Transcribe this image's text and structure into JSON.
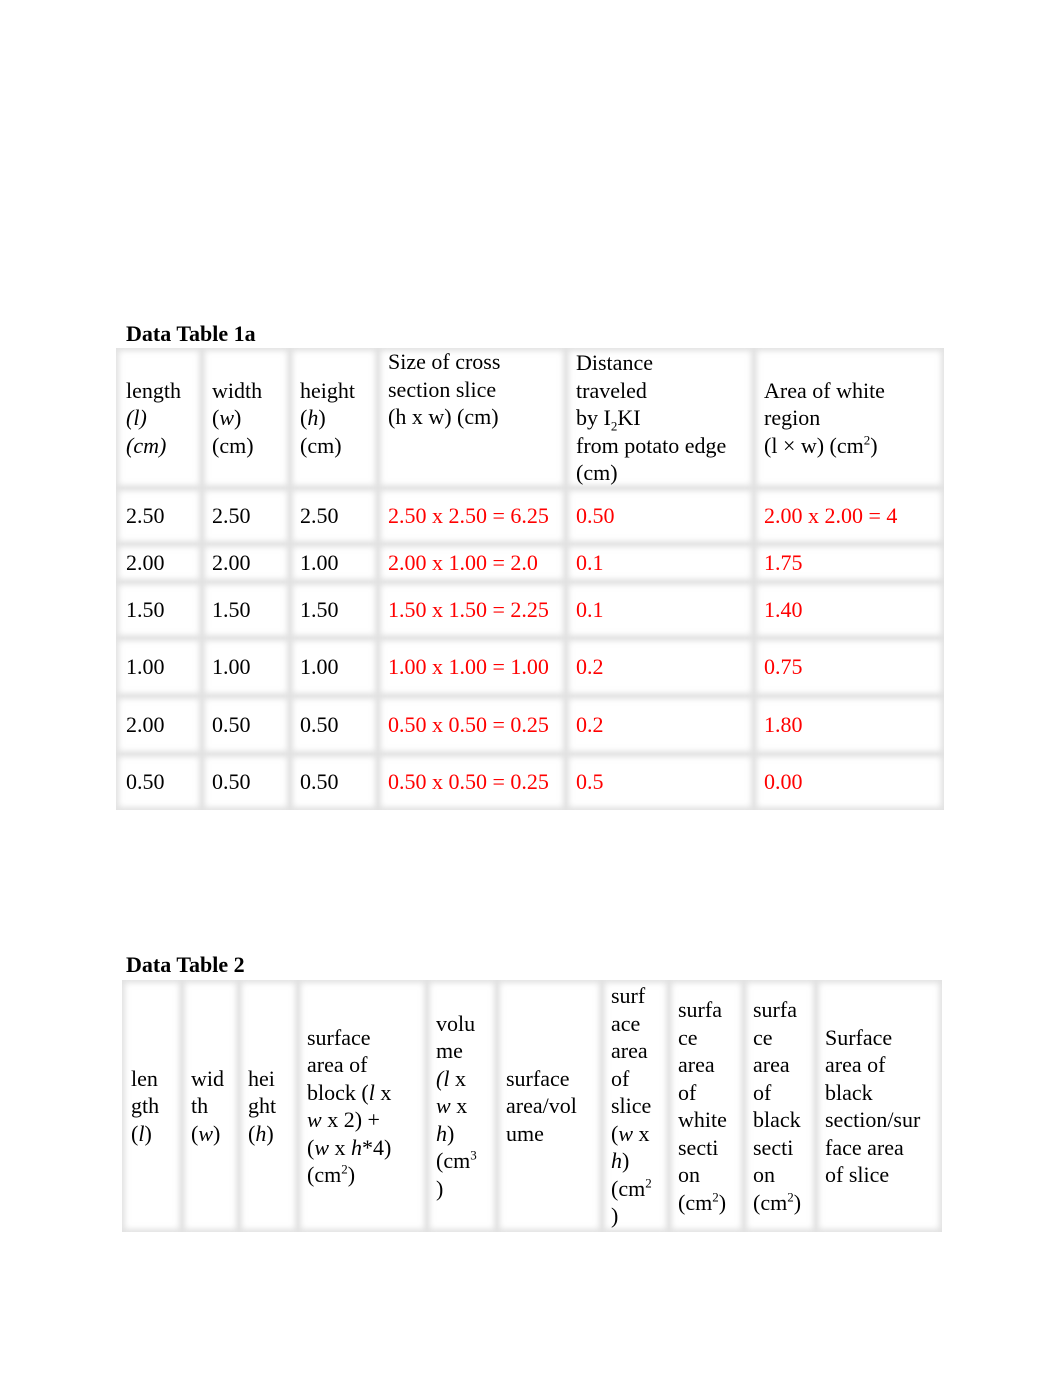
{
  "table1": {
    "caption": "Data Table 1a",
    "headers": {
      "length": [
        "length",
        "(",
        "l",
        ")",
        "(cm)"
      ],
      "width": [
        "width",
        "(",
        "w",
        ")",
        "(cm)"
      ],
      "height": [
        "height",
        "(",
        "h",
        ")",
        "(cm)"
      ],
      "cross_section": [
        "Size of cross",
        "section slice",
        "(h x w) (cm)"
      ],
      "distance": [
        "Distance",
        "traveled",
        "by I",
        "2",
        "KI",
        "from potato edge",
        "(cm)"
      ],
      "white_area": [
        "Area of white",
        "region",
        "(l × w) (cm",
        "2",
        ")"
      ]
    },
    "rows": [
      {
        "length": "2.50",
        "width": "2.50",
        "height": "2.50",
        "cross_section": "2.50 x 2.50 = 6.25",
        "distance": "0.50",
        "white_area": "2.00 x 2.00 = 4"
      },
      {
        "length": "2.00",
        "width": "2.00",
        "height": "1.00",
        "cross_section": "2.00 x 1.00 = 2.0",
        "distance": "0.1",
        "white_area": "1.75"
      },
      {
        "length": "1.50",
        "width": "1.50",
        "height": "1.50",
        "cross_section": "1.50 x 1.50 = 2.25",
        "distance": "0.1",
        "white_area": "1.40"
      },
      {
        "length": "1.00",
        "width": "1.00",
        "height": "1.00",
        "cross_section": "1.00 x 1.00 = 1.00",
        "distance": "0.2",
        "white_area": "0.75"
      },
      {
        "length": "2.00",
        "width": "0.50",
        "height": "0.50",
        "cross_section": "0.50 x 0.50 = 0.25",
        "distance": "0.2",
        "white_area": "1.80"
      },
      {
        "length": "0.50",
        "width": "0.50",
        "height": "0.50",
        "cross_section": "0.50 x 0.50 = 0.25",
        "distance": "0.5",
        "white_area": "0.00"
      }
    ],
    "answer_color": "#ff0000"
  },
  "table2": {
    "caption": "Data Table 2",
    "headers": {
      "length": [
        "len",
        "gth",
        "(",
        "l",
        ")"
      ],
      "width": [
        "wid",
        "th",
        "(",
        "w",
        ")"
      ],
      "height": [
        "hei",
        "ght",
        "(",
        "h",
        ")"
      ],
      "block_sa": [
        "surface",
        "area of",
        "block (",
        "l",
        " x",
        "w",
        " x 2) +",
        "(",
        "w",
        " x ",
        "h",
        "*4)",
        "(cm",
        "2",
        ")"
      ],
      "volume": [
        "volu",
        "me",
        "(l",
        " x",
        "w",
        " x",
        "h",
        ")",
        "(cm",
        "3",
        ")"
      ],
      "sa_vol": [
        "surface",
        "area/vol",
        "ume"
      ],
      "slice_sa": [
        "surf",
        "ace",
        "area",
        "of",
        "slice",
        "(",
        "w",
        " x",
        "h",
        ")",
        "(cm",
        "2",
        ")"
      ],
      "white_sa": [
        "surfa",
        "ce",
        "area",
        "of",
        "white",
        "secti",
        "on",
        "(cm",
        "2",
        ")"
      ],
      "black_sa": [
        "surfa",
        "ce",
        "area",
        "of",
        "black",
        "secti",
        "on",
        "(cm",
        "2",
        ")"
      ],
      "ratio": [
        "Surface",
        "area of",
        "black",
        "section/sur",
        "face area",
        "of slice"
      ]
    }
  }
}
